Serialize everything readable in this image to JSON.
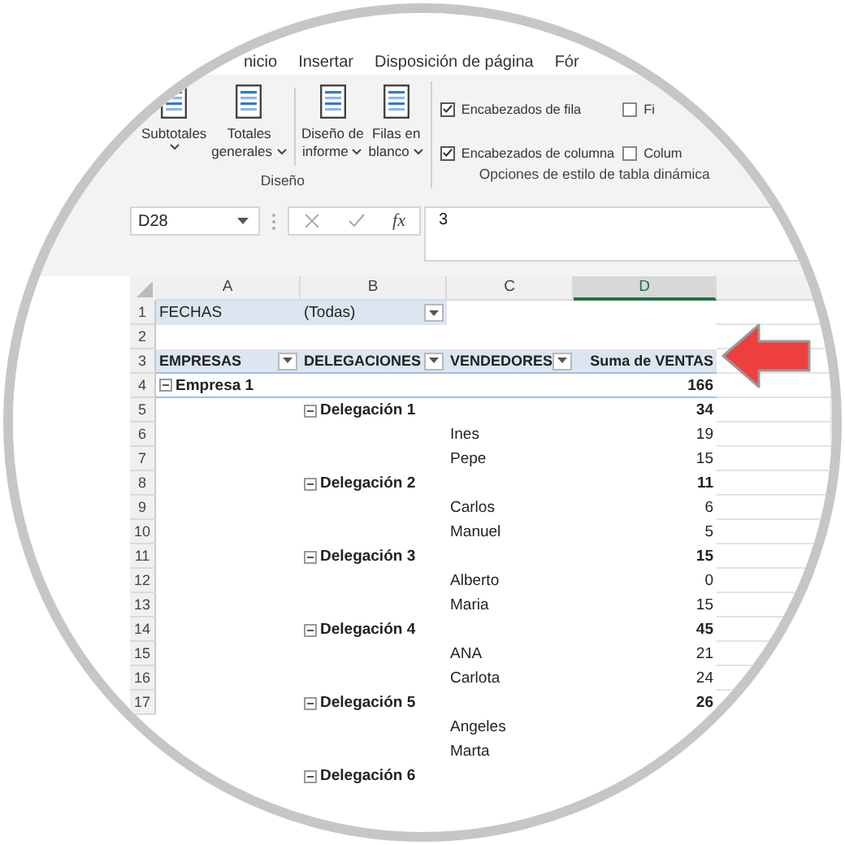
{
  "ribbon_tabs": [
    "nicio",
    "Insertar",
    "Disposición de página",
    "Fór"
  ],
  "layout_group": {
    "label": "Diseño",
    "buttons": [
      {
        "lines": [
          "Subtotales"
        ],
        "dropdown": true,
        "caret_below": true
      },
      {
        "lines": [
          "Totales",
          "generales"
        ],
        "dropdown": true,
        "caret_below": false
      },
      {
        "lines": [
          "Diseño de",
          "informe"
        ],
        "dropdown": true,
        "caret_below": false
      },
      {
        "lines": [
          "Filas en",
          "blanco"
        ],
        "dropdown": true,
        "caret_below": false
      }
    ]
  },
  "style_options_group": {
    "label": "Opciones de estilo de tabla dinámica",
    "checkboxes": [
      {
        "label": "Encabezados de fila",
        "checked": true
      },
      {
        "label": "Encabezados de columna",
        "checked": true
      },
      {
        "label": "Fi",
        "checked": false
      },
      {
        "label": "Colum",
        "checked": false
      }
    ]
  },
  "formula_bar": {
    "name_box": "D28",
    "insert_function": "fx",
    "formula": "3"
  },
  "columns": [
    {
      "label": "A",
      "selected": false
    },
    {
      "label": "B",
      "selected": false
    },
    {
      "label": "C",
      "selected": false
    },
    {
      "label": "D",
      "selected": true
    }
  ],
  "rows": [
    {
      "kind": "filter",
      "number": "1",
      "page_field": "FECHAS",
      "page_value": "(Todas)"
    },
    {
      "kind": "blank",
      "number": "2"
    },
    {
      "kind": "header",
      "number": "3",
      "cells": [
        "EMPRESAS",
        "DELEGACIONES",
        "VENDEDORES",
        "Suma de VENTAS"
      ]
    },
    {
      "kind": "empresa",
      "number": "4",
      "label": "Empresa 1",
      "value": "166"
    },
    {
      "kind": "delegacion",
      "number": "5",
      "label": "Delegación 1",
      "value": "34"
    },
    {
      "kind": "vendedor",
      "number": "6",
      "label": "Ines",
      "value": "19"
    },
    {
      "kind": "vendedor",
      "number": "7",
      "label": "Pepe",
      "value": "15"
    },
    {
      "kind": "delegacion",
      "number": "8",
      "label": "Delegación 2",
      "value": "11"
    },
    {
      "kind": "vendedor",
      "number": "9",
      "label": "Carlos",
      "value": "6"
    },
    {
      "kind": "vendedor",
      "number": "10",
      "label": "Manuel",
      "value": "5"
    },
    {
      "kind": "delegacion",
      "number": "11",
      "label": "Delegación 3",
      "value": "15"
    },
    {
      "kind": "vendedor",
      "number": "12",
      "label": "Alberto",
      "value": "0"
    },
    {
      "kind": "vendedor",
      "number": "13",
      "label": "Maria",
      "value": "15"
    },
    {
      "kind": "delegacion",
      "number": "14",
      "label": "Delegación 4",
      "value": "45"
    },
    {
      "kind": "vendedor",
      "number": "15",
      "label": "ANA",
      "value": "21"
    },
    {
      "kind": "vendedor",
      "number": "16",
      "label": "Carlota",
      "value": "24"
    },
    {
      "kind": "delegacion",
      "number": "17",
      "label": "Delegación 5",
      "value": "26"
    },
    {
      "kind": "vendedor",
      "label": "Angeles"
    },
    {
      "kind": "vendedor",
      "label": "Marta"
    },
    {
      "kind": "delegacion",
      "label": "Delegación 6"
    }
  ]
}
